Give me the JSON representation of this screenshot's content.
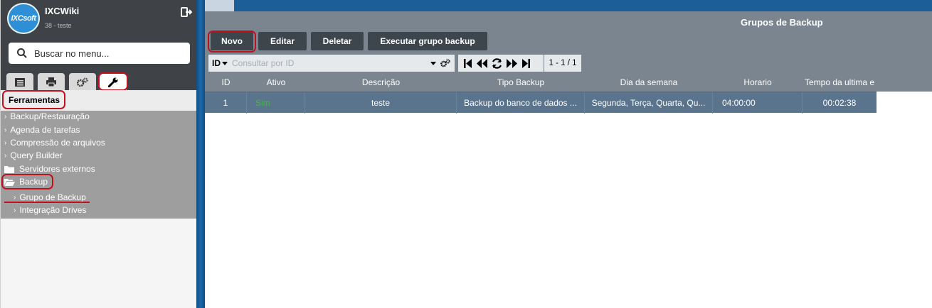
{
  "sidebar": {
    "app_name": "IXCWiki",
    "app_sub": "38 - teste",
    "logo_text": "IXCsoft",
    "search_placeholder": "Buscar no menu...",
    "tabs": [
      {
        "icon": "list-icon"
      },
      {
        "icon": "printer-icon"
      },
      {
        "icon": "gears-icon"
      },
      {
        "icon": "wrench-icon",
        "active": true
      }
    ],
    "section_title": "Ferramentas",
    "items": [
      {
        "label": "Backup/Restauração"
      },
      {
        "label": "Agenda de tarefas"
      },
      {
        "label": "Compressão de arquivos"
      },
      {
        "label": "Query Builder"
      },
      {
        "label": "Servidores externos"
      },
      {
        "label": "Backup"
      },
      {
        "label": "Grupo de Backup"
      },
      {
        "label": "Integração Drives"
      }
    ]
  },
  "window": {
    "title": "Grupos de Backup",
    "buttons": {
      "novo": "Novo",
      "editar": "Editar",
      "deletar": "Deletar",
      "executar": "Executar grupo backup"
    },
    "filter": {
      "field": "ID",
      "placeholder": "Consultar por ID"
    },
    "pager": {
      "count": "1 - 1 / 1"
    },
    "columns": [
      "ID",
      "Ativo",
      "Descrição",
      "Tipo Backup",
      "Dia da semana",
      "Horario",
      "Tempo da ultima e"
    ],
    "rows": [
      {
        "id": "1",
        "ativo": "Sim",
        "descricao": "teste",
        "tipo": "Backup do banco de dados ...",
        "dia": "Segunda, Terça, Quarta, Qu...",
        "horario": "04:00:00",
        "tempo": "00:02:38"
      }
    ]
  },
  "colors": {
    "accent_ring": "#c0111f",
    "header_bg": "#7a8590",
    "selected_row": "#5b748e",
    "ativo_green": "#4caf50"
  }
}
